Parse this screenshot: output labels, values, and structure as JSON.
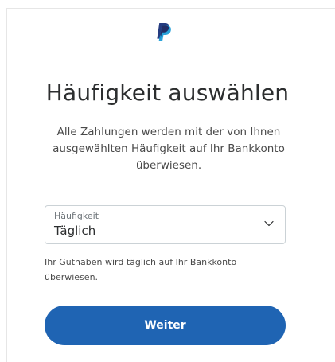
{
  "brand": {
    "logo_icon": "paypal-logo-icon",
    "colors": {
      "primary": "#1f64b3",
      "logo_dark": "#253b80",
      "logo_light": "#179bd7"
    }
  },
  "header": {
    "title": "Häufigkeit auswählen",
    "description": "Alle Zahlungen werden mit der von Ihnen ausgewählten Häufigkeit auf Ihr Bankkonto überwiesen."
  },
  "frequency_select": {
    "label": "Häufigkeit",
    "selected_value": "Täglich",
    "icon": "chevron-down-icon"
  },
  "helper_text": "Ihr Guthaben wird täglich auf Ihr Bankkonto überwiesen.",
  "actions": {
    "continue_label": "Weiter"
  }
}
